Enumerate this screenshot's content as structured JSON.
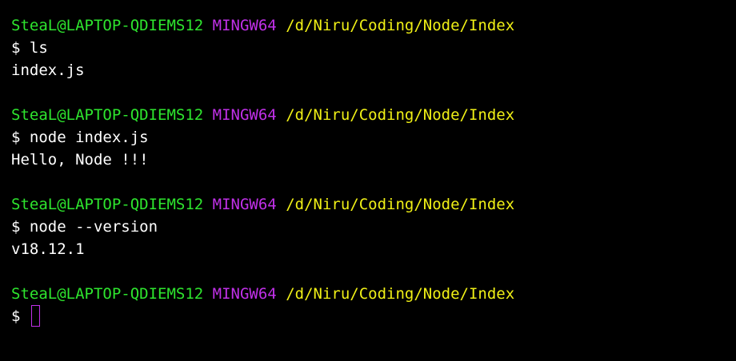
{
  "session": [
    {
      "prompt": {
        "user_host": "SteaL@LAPTOP-QDIEMS12",
        "system": "MINGW64",
        "path": "/d/Niru/Coding/Node/Index"
      },
      "command": "ls",
      "output": "index.js"
    },
    {
      "prompt": {
        "user_host": "SteaL@LAPTOP-QDIEMS12",
        "system": "MINGW64",
        "path": "/d/Niru/Coding/Node/Index"
      },
      "command": "node index.js",
      "output": "Hello, Node !!!"
    },
    {
      "prompt": {
        "user_host": "SteaL@LAPTOP-QDIEMS12",
        "system": "MINGW64",
        "path": "/d/Niru/Coding/Node/Index"
      },
      "command": "node --version",
      "output": "v18.12.1"
    }
  ],
  "current_prompt": {
    "user_host": "SteaL@LAPTOP-QDIEMS12",
    "system": "MINGW64",
    "path": "/d/Niru/Coding/Node/Index",
    "input": ""
  },
  "prompt_symbol": "$",
  "colors": {
    "user_host": "#2ee52e",
    "system": "#c030e8",
    "path": "#f0f016",
    "text": "#ffffff",
    "background": "#000000",
    "cursor": "#c030e8"
  }
}
